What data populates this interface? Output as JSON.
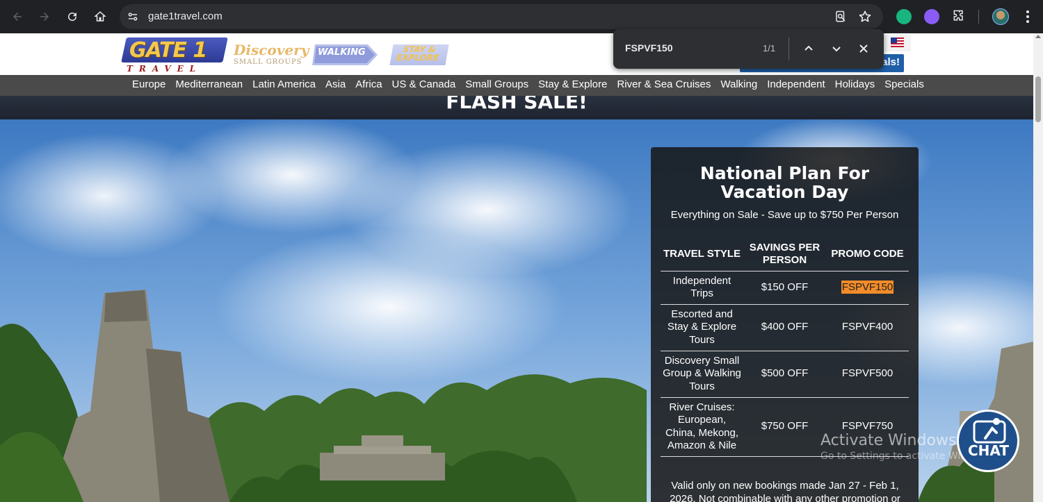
{
  "browser": {
    "url": "gate1travel.com",
    "find_query": "FSPVF150",
    "find_count": "1/1"
  },
  "header": {
    "logo_main": "GATE 1",
    "logo_travel": "TRAVEL",
    "logo_discovery": "Discovery",
    "logo_discovery_sub": "SMALL GROUPS",
    "logo_walking": "WALKING",
    "logo_stay_line1": "STAY &",
    "logo_stay_line2": "EXPLORE",
    "deals_button": "als!"
  },
  "nav": {
    "items": [
      "Europe",
      "Mediterranean",
      "Latin America",
      "Asia",
      "Africa",
      "US & Canada",
      "Small Groups",
      "Stay & Explore",
      "River & Sea Cruises",
      "Walking",
      "Independent",
      "Holidays",
      "Specials"
    ]
  },
  "banner": {
    "flash_sale": "FLASH SALE!"
  },
  "promo": {
    "title": "National Plan For Vacation Day",
    "subtitle": "Everything on Sale - Save up to $750 Per Person",
    "columns": [
      "TRAVEL STYLE",
      "SAVINGS PER PERSON",
      "PROMO CODE"
    ],
    "rows": [
      {
        "style": "Independent Trips",
        "savings": "$150 OFF",
        "code": "FSPVF150"
      },
      {
        "style": "Escorted and Stay & Explore Tours",
        "savings": "$400 OFF",
        "code": "FSPVF400"
      },
      {
        "style": "Discovery Small Group & Walking Tours",
        "savings": "$500 OFF",
        "code": "FSPVF500"
      },
      {
        "style": "River Cruises: European, China, Mekong, Amazon & Nile",
        "savings": "$750 OFF",
        "code": "FSPVF750"
      }
    ],
    "note": "Valid only on new bookings made Jan 27 - Feb 1, 2026. Not combinable with any other promotion or"
  },
  "watermark": {
    "title": "Activate Windows",
    "subtitle": "Go to Settings to activate Windows."
  },
  "chat": {
    "label": "CHAT"
  },
  "colors": {
    "nav_bg": "#4a4a4a",
    "highlight": "#f28c28",
    "chat_bg": "#1f4f8a",
    "deals_bg": "#1f5fa8"
  }
}
